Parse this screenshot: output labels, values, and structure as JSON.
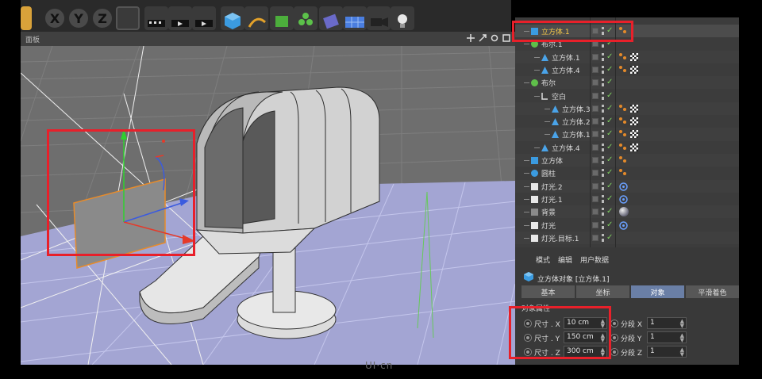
{
  "toolbar": {
    "icons": [
      "undo-arc-icon",
      "axis-x-lock-icon",
      "axis-y-lock-icon",
      "axis-z-lock-icon",
      "world-coords-icon",
      "render-view-icon",
      "render-picture-icon",
      "render-settings-icon",
      "cube-primitive-icon",
      "spline-pen-icon",
      "nurbs-icon",
      "array-icon",
      "deformer-icon",
      "floor-icon",
      "camera-icon",
      "light-icon"
    ],
    "axis_x": "X",
    "axis_y": "Y",
    "axis_z": "Z"
  },
  "viewport": {
    "title": "面板"
  },
  "object_manager": {
    "objects": [
      {
        "name": "立方体.1",
        "indent": 0,
        "icon": "cube-icon",
        "selected": true
      },
      {
        "name": "布尔.1",
        "indent": 0,
        "icon": "boole-icon"
      },
      {
        "name": "立方体.1",
        "indent": 1,
        "icon": "polygon-object-icon"
      },
      {
        "name": "立方体.4",
        "indent": 1,
        "icon": "polygon-object-icon"
      },
      {
        "name": "布尔",
        "indent": 0,
        "icon": "boole-icon"
      },
      {
        "name": "空白",
        "indent": 1,
        "icon": "null-object-icon"
      },
      {
        "name": "立方体.3",
        "indent": 2,
        "icon": "polygon-object-icon"
      },
      {
        "name": "立方体.2",
        "indent": 2,
        "icon": "polygon-object-icon"
      },
      {
        "name": "立方体.1",
        "indent": 2,
        "icon": "polygon-object-icon"
      },
      {
        "name": "立方体.4",
        "indent": 1,
        "icon": "polygon-object-icon"
      },
      {
        "name": "立方体",
        "indent": 0,
        "icon": "cube-icon"
      },
      {
        "name": "圆柱",
        "indent": 0,
        "icon": "cylinder-icon"
      },
      {
        "name": "灯光.2",
        "indent": 0,
        "icon": "light-icon"
      },
      {
        "name": "灯光.1",
        "indent": 0,
        "icon": "light-icon"
      },
      {
        "name": "背景",
        "indent": 0,
        "icon": "background-icon"
      },
      {
        "name": "灯光",
        "indent": 0,
        "icon": "light-icon"
      },
      {
        "name": "灯光.目标.1",
        "indent": 0,
        "icon": "target-light-icon"
      }
    ]
  },
  "attributes": {
    "menu": [
      "模式",
      "编辑",
      "用户数据"
    ],
    "object_title": "立方体对象 [立方体.1]",
    "tabs": [
      "基本",
      "坐标",
      "对象",
      "平滑着色"
    ],
    "active_tab": "对象",
    "section": "对象属性",
    "size_x_label": "尺寸 . X",
    "size_x_value": "10 cm",
    "size_y_label": "尺寸 . Y",
    "size_y_value": "150 cm",
    "size_z_label": "尺寸 . Z",
    "size_z_value": "300 cm",
    "seg_x_label": "分段 X",
    "seg_x_value": "1",
    "seg_y_label": "分段 Y",
    "seg_y_value": "1",
    "seg_z_label": "分段 Z",
    "seg_z_value": "1"
  },
  "colors": {
    "highlight": "#e8202a",
    "selected_text": "#f5c94a",
    "active_tab": "#6a7fa6"
  }
}
